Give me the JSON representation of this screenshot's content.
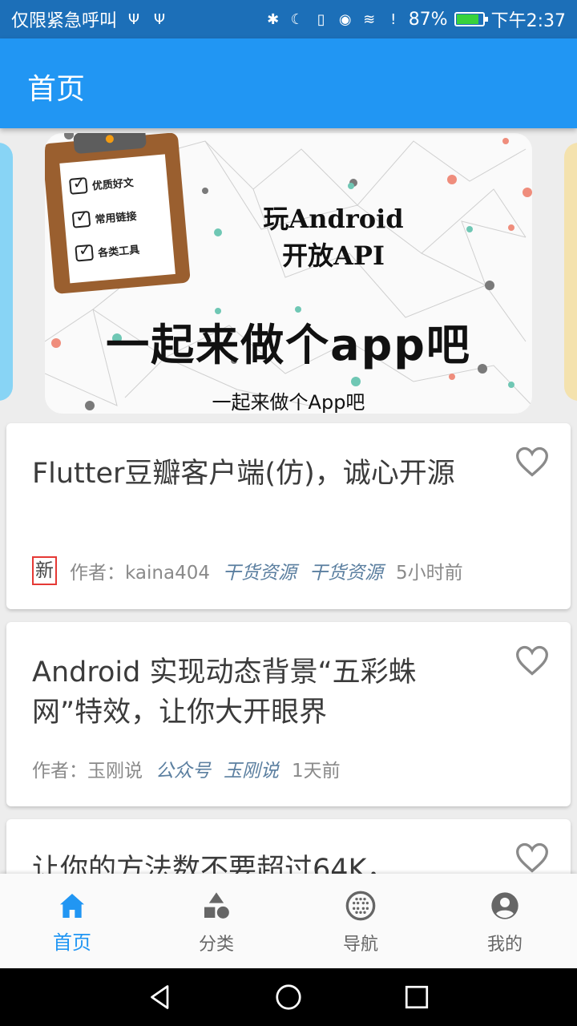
{
  "status_bar": {
    "carrier": "仅限紧急呼叫",
    "battery": "87%",
    "battery_level": 0.87,
    "time": "下午2:37"
  },
  "app_bar": {
    "title": "首页"
  },
  "banner": {
    "checklist": [
      "优质好文",
      "常用链接",
      "各类工具"
    ],
    "heading_line1": "玩Android",
    "heading_line2": "开放API",
    "big_text": "一起来做个app吧",
    "caption": "一起来做个App吧"
  },
  "articles": [
    {
      "title": "Flutter豆瓣客户端(仿)，诚心开源",
      "is_new": true,
      "new_label": "新",
      "author": "作者：kaina404",
      "super_chapter": "干货资源",
      "chapter": "干货资源",
      "time": "5小时前"
    },
    {
      "title": "Android 实现动态背景“五彩蛛网”特效，让你大开眼界",
      "is_new": false,
      "author": "作者：玉刚说",
      "super_chapter": "公众号",
      "chapter": "玉刚说",
      "time": "1天前"
    },
    {
      "title": "让你的方法数不要超过64K，"
    }
  ],
  "bottom_nav": [
    {
      "label": "首页",
      "icon": "home-icon",
      "active": true
    },
    {
      "label": "分类",
      "icon": "category-icon",
      "active": false
    },
    {
      "label": "导航",
      "icon": "navigation-icon",
      "active": false
    },
    {
      "label": "我的",
      "icon": "account-icon",
      "active": false
    }
  ],
  "colors": {
    "primary": "#2196f3",
    "status_bar": "#1c6fb8",
    "new_tag_border": "#e53935",
    "chapter_text": "#5b7fa0"
  }
}
